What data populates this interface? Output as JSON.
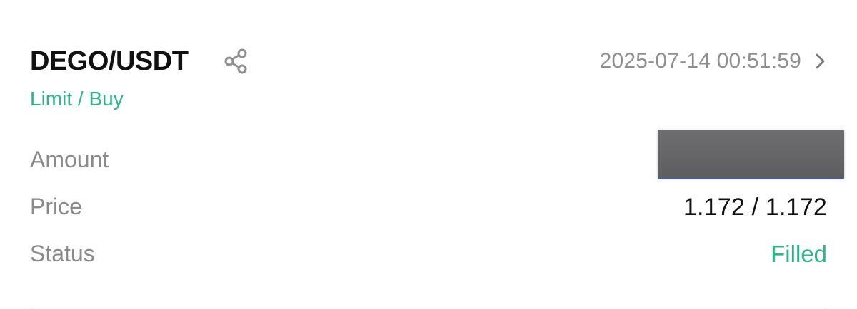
{
  "order": {
    "pair": "DEGO/USDT",
    "timestamp": "2025-07-14 00:51:59",
    "order_type": "Limit / Buy",
    "rows": {
      "amount_label": "Amount",
      "price_label": "Price",
      "price_value": "1.172 / 1.172",
      "status_label": "Status",
      "status_value": "Filled"
    }
  },
  "icons": {
    "share": "share-icon",
    "chevron": "chevron-right-icon"
  },
  "colors": {
    "accent_green": "#2fb58a",
    "text_primary": "#111111",
    "text_secondary": "#8a8a8a",
    "redaction": "#656567"
  }
}
